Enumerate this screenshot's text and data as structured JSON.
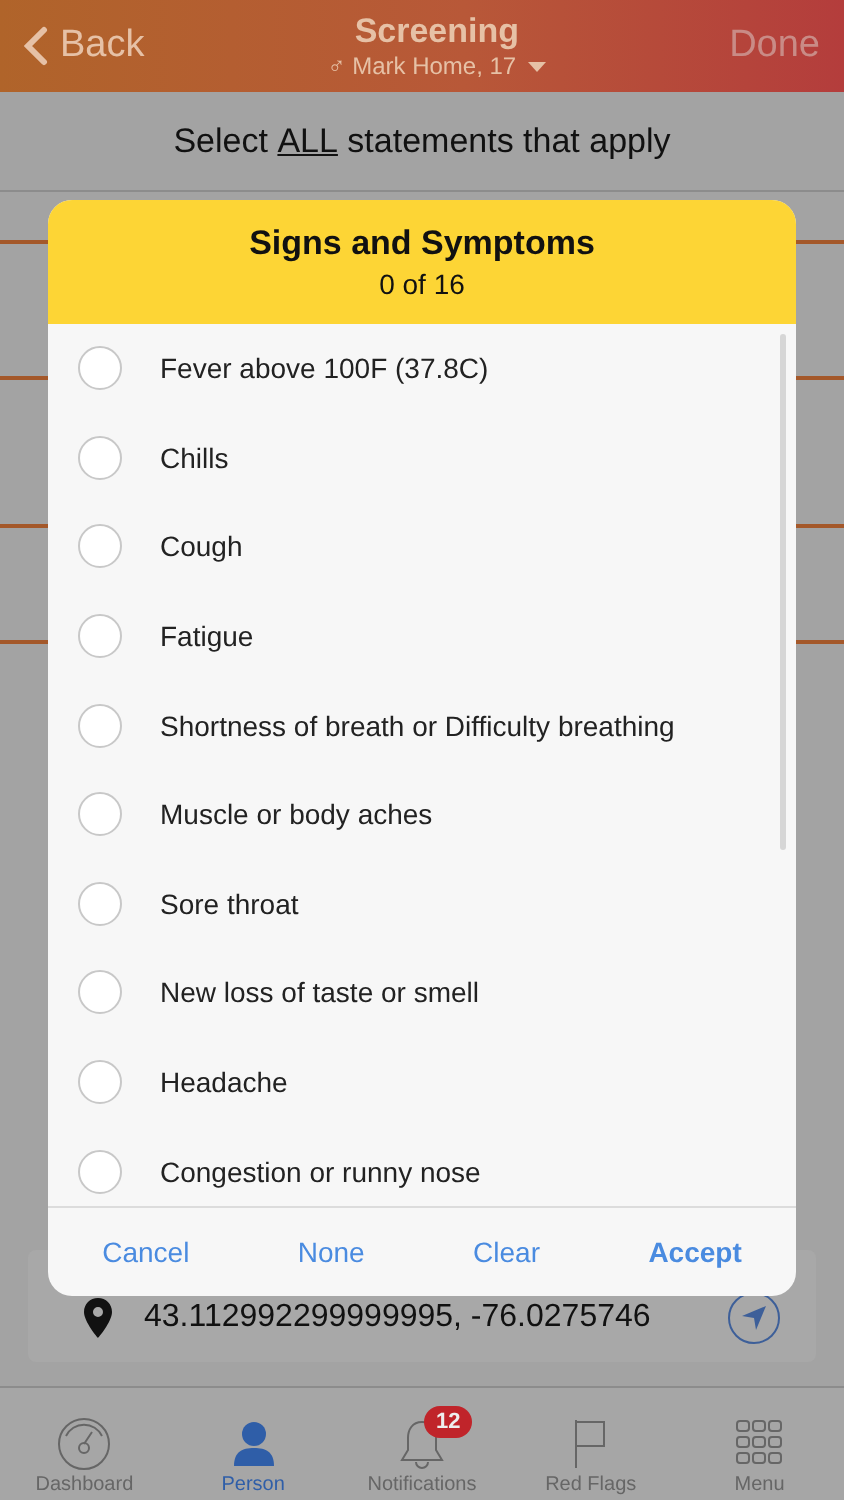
{
  "nav": {
    "back": "Back",
    "title": "Screening",
    "subtitle": "♂ Mark Home, 17",
    "done": {
      "label": "Done",
      "disabled": true
    }
  },
  "instruction": {
    "before": "Select ",
    "emphasis": "ALL",
    "after": " statements that apply"
  },
  "location": {
    "coordinates": "43.112992299999995, -76.0275746"
  },
  "dialog": {
    "title": "Signs and Symptoms",
    "count": "0 of 16",
    "options": [
      {
        "label": "Fever above 100F (37.8C)",
        "checked": false
      },
      {
        "label": "Chills",
        "checked": false
      },
      {
        "label": "Cough",
        "checked": false
      },
      {
        "label": "Fatigue",
        "checked": false
      },
      {
        "label": "Shortness of breath or Difficulty breathing",
        "checked": false
      },
      {
        "label": "Muscle or body aches",
        "checked": false
      },
      {
        "label": "Sore throat",
        "checked": false
      },
      {
        "label": "New loss of taste or smell",
        "checked": false
      },
      {
        "label": "Headache",
        "checked": false
      },
      {
        "label": "Congestion or runny nose",
        "checked": false
      }
    ],
    "buttons": [
      {
        "label": "Cancel",
        "primary": false
      },
      {
        "label": "None",
        "primary": false
      },
      {
        "label": "Clear",
        "primary": false
      },
      {
        "label": "Accept",
        "primary": true
      }
    ]
  },
  "tabs": [
    {
      "label": "Dashboard",
      "kind": "gauge",
      "selected": false
    },
    {
      "label": "Person",
      "kind": "person",
      "selected": true
    },
    {
      "label": "Notifications",
      "kind": "bell",
      "selected": false,
      "badge": "12"
    },
    {
      "label": "Red Flags",
      "kind": "flag",
      "selected": false
    },
    {
      "label": "Menu",
      "kind": "grid",
      "selected": false
    }
  ]
}
